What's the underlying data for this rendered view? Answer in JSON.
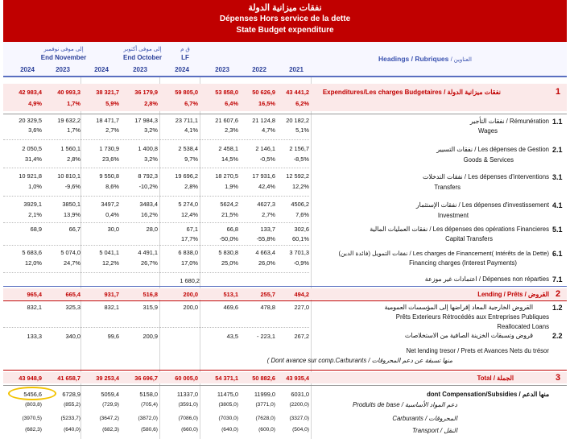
{
  "title": {
    "ar": "نفقات ميزانية الدولة",
    "fr": "Dépenses Hors service de la dette",
    "en": "State Budget expenditure"
  },
  "header": {
    "end_november_ar": "إلى موفى نوفمبر",
    "end_november": "End November",
    "end_october_ar": "إلى موفى أكتوبر",
    "end_october": "End October",
    "lf_ar": "ق م",
    "lf": "LF",
    "headings": "Headings / Rubriques",
    "headings_ar": "العناوين",
    "years": [
      "2024",
      "2023",
      "2024",
      "2023",
      "2024",
      "2023",
      "2022",
      "2021"
    ]
  },
  "rows": {
    "r1": {
      "num": "1",
      "label": "Expenditures/Les charges Budgetaires",
      "label_ar": "نفقات ميزانية الدولة",
      "values": [
        "42 983,4",
        "40 993,3",
        "38 321,7",
        "36 179,9",
        "59 805,0",
        "53 858,0",
        "50 626,9",
        "43 441,2"
      ],
      "pcts": [
        "4,9%",
        "1,7%",
        "5,9%",
        "2,8%",
        "6,7%",
        "6,4%",
        "16,5%",
        "6,2%"
      ]
    },
    "r11": {
      "num": "1.1",
      "label_ar": "نفقات التأجير",
      "label": "Rémunération",
      "label2": "Wages",
      "values": [
        "20 329,5",
        "19 632,2",
        "18 471,7",
        "17 984,3",
        "23 711,1",
        "21 607,6",
        "21 124,8",
        "20 182,2"
      ],
      "pcts": [
        "3,6%",
        "1,7%",
        "2,7%",
        "3,2%",
        "4,1%",
        "2,3%",
        "4,7%",
        "5,1%"
      ]
    },
    "r21": {
      "num": "2.1",
      "label_ar": "نفقات التسيير",
      "label": "Les dépenses de Gestion",
      "label2": "Goods & Services",
      "values": [
        "2 050,5",
        "1 560,1",
        "1 730,9",
        "1 400,8",
        "2 538,4",
        "2 458,1",
        "2 146,1",
        "2 156,7"
      ],
      "pcts": [
        "31,4%",
        "2,8%",
        "23,6%",
        "3,2%",
        "9,7%",
        "14,5%",
        "-0,5%",
        "-8,5%"
      ]
    },
    "r31": {
      "num": "3.1",
      "label_ar": "نفقات التدخلات",
      "label": "Les dépenses d'interventions",
      "label2": "Transfers",
      "values": [
        "10 921,8",
        "10 810,1",
        "9 550,8",
        "8 792,3",
        "19 696,2",
        "18 270,5",
        "17 931,6",
        "12 592,2"
      ],
      "pcts": [
        "1,0%",
        "-9,6%",
        "8,6%",
        "-10,2%",
        "2,8%",
        "1,9%",
        "42,4%",
        "12,2%"
      ]
    },
    "r41": {
      "num": "4.1",
      "label_ar": "نفقات الإستثمار",
      "label": "Les dépenses d'investissement",
      "label2": "Investment",
      "values": [
        "3929,1",
        "3850,1",
        "3497,2",
        "3483,4",
        "5 274,0",
        "5624,2",
        "4627,3",
        "4506,2"
      ],
      "pcts": [
        "2,1%",
        "13,9%",
        "0,4%",
        "16,2%",
        "12,4%",
        "21,5%",
        "2,7%",
        "7,6%"
      ]
    },
    "r51": {
      "num": "5.1",
      "label_ar": "نفقات العمليات المالية",
      "label": "Les dépenses des opérations Financieres",
      "label2": "Capital Transfers",
      "values": [
        "68,9",
        "66,7",
        "30,0",
        "28,0",
        "67,1",
        "66,8",
        "133,7",
        "302,6"
      ],
      "pcts": [
        "",
        "",
        "",
        "",
        "17,7%",
        "-50,0%",
        "-55,8%",
        "60,1%"
      ]
    },
    "r61": {
      "num": "6.1",
      "label_ar": "نفقات التمويل (فائدة الدين)",
      "label": "Les charges de Financement( Intérêts de la Dette)",
      "label2": "Financing charges (Interest Payments)",
      "values": [
        "5 683,6",
        "5 074,0",
        "5 041,1",
        "4 491,1",
        "6 838,0",
        "5 830,8",
        "4 663,4",
        "3 701,3"
      ],
      "pcts": [
        "12,0%",
        "24,7%",
        "12,2%",
        "26,7%",
        "17,0%",
        "25,0%",
        "26,0%",
        "-0,9%"
      ]
    },
    "r71": {
      "num": "7.1",
      "label_ar": "اعتمادات غير موزعة",
      "label": "Dépenses non réparties",
      "lf_value": "1 680,2"
    },
    "r2": {
      "num": "2",
      "label": "Lending / Prêts",
      "label_ar": "القروض",
      "values": [
        "965,4",
        "665,4",
        "931,7",
        "516,8",
        "200,0",
        "513,1",
        "255,7",
        "494,2"
      ]
    },
    "r12": {
      "num": "1.2",
      "label_ar": "القروض الخارجية المعاد إقراضها إلى المؤسسات العمومية",
      "label": "Prêts Exterieurs Rétrocédés aux Entreprises Publiques",
      "label2": "Reallocated Loans",
      "values": [
        "832,1",
        "325,3",
        "832,1",
        "315,9",
        "200,0",
        "469,6",
        "478,8",
        "227,0"
      ]
    },
    "r22": {
      "num": "2.2",
      "label_ar": "قروض وتسبقات الخزينة الصافية من الاستخلاصات",
      "label": "Net lending tresor / Prets et Avances Nets du trésor",
      "label2": "( Dont avance sur comp.Carburants",
      "label2_ar": "منها تسبقة عن دعم المحروقات",
      "values": [
        "133,3",
        "340,0",
        "99,6",
        "200,9",
        "",
        "43,5",
        "- 223,1",
        "267,2"
      ]
    },
    "r3": {
      "num": "3",
      "label": "Total",
      "label_ar": "الجملة",
      "values": [
        "43 948,9",
        "41 658,7",
        "39 253,4",
        "36 696,7",
        "60 005,0",
        "54 371,1",
        "50 882,6",
        "43 935,4"
      ]
    },
    "comp": {
      "label": "dont Compensation/Subsidies",
      "label_ar": "منها الدعم",
      "values": [
        "5456,6",
        "6728,9",
        "5059,4",
        "5158,0",
        "11337,0",
        "11475,0",
        "11999,0",
        "6031,0"
      ]
    },
    "base": {
      "label": "Produits de base",
      "label_ar": "دعم المواد الأساسية",
      "values": [
        "(803,8)",
        "(855,2)",
        "(729,9)",
        "(705,4)",
        "(3591,0)",
        "(3805,0)",
        "(3771,0)",
        "(2200,0)"
      ]
    },
    "carb": {
      "label": "Carburants",
      "label_ar": "المحروقات",
      "values": [
        "(3970,5)",
        "(5233,7)",
        "(3647,2)",
        "(3872,0)",
        "(7086,0)",
        "(7030,0)",
        "(7628,0)",
        "(3327,0)"
      ]
    },
    "transp": {
      "label": "Transport",
      "label_ar": "النقل",
      "values": [
        "(682,3)",
        "(640,0)",
        "(682,3)",
        "(580,6)",
        "(660,0)",
        "(640,0)",
        "(600,0)",
        "(504,0)"
      ]
    }
  },
  "colors": {
    "accent_red": "#c00000",
    "accent_blue": "#5a6fc0",
    "highlight": "#f2c200"
  }
}
